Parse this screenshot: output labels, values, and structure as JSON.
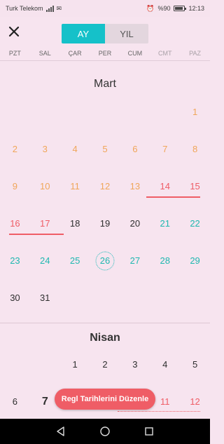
{
  "status": {
    "carrier": "Turk Telekom",
    "battery": "%90",
    "time": "12:13"
  },
  "toggle": {
    "month_label": "AY",
    "year_label": "YIL"
  },
  "weekdays": [
    "PZT",
    "SAL",
    "ÇAR",
    "PER",
    "CUM",
    "CMT",
    "PAZ"
  ],
  "march": {
    "title": "Mart"
  },
  "april": {
    "title": "Nisan"
  },
  "fab_label": "Regl Tarihlerini Düzenle",
  "icons": {
    "close": "close-icon",
    "back": "back-icon",
    "home": "home-icon",
    "recents": "recents-icon"
  },
  "colors": {
    "accent": "#15c1c9",
    "period": "#ef5d66",
    "fertile": "#1fb8b0",
    "normal": "#f0a65a"
  }
}
